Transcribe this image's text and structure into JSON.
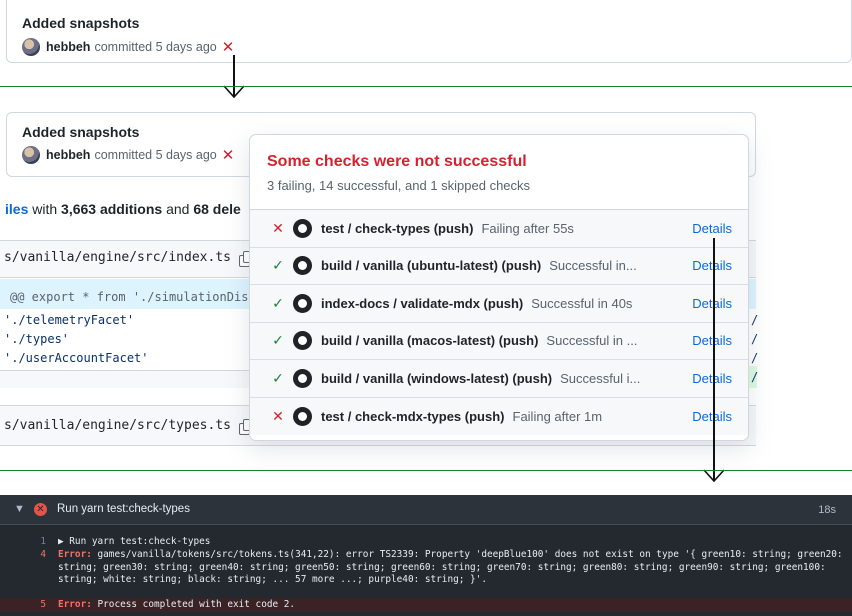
{
  "commit_top": {
    "title": "Added snapshots",
    "author": "hebbeh",
    "meta": "committed 5 days ago",
    "status_icon": "x-mark-icon"
  },
  "commit_mid": {
    "title": "Added snapshots",
    "author": "hebbeh",
    "meta": "committed 5 days ago",
    "status_icon": "x-mark-icon"
  },
  "files_summary": {
    "link": "iles",
    "with": " with ",
    "additions": "3,663 additions",
    "and": " and ",
    "deletions": "68 dele"
  },
  "file1": {
    "path": "s/vanilla/engine/src/index.ts",
    "hunk": "@@ export * from './simulationDis",
    "lines": [
      "'./telemetryFacet'",
      "'./types'",
      "'./userAccountFacet'"
    ]
  },
  "file2": {
    "path": "s/vanilla/engine/src/types.ts"
  },
  "right_fragments": [
    "/",
    "/",
    "/",
    "/"
  ],
  "popover": {
    "title": "Some checks were not successful",
    "subtitle": "3 failing, 14 successful, and 1 skipped checks",
    "details_label": "Details",
    "checks": [
      {
        "status": "fail",
        "icon": "x-mark",
        "name": "test / check-types (push)",
        "desc": "Failing after 55s"
      },
      {
        "status": "pass",
        "icon": "check-mark",
        "name": "build / vanilla (ubuntu-latest) (push)",
        "desc": "Successful in..."
      },
      {
        "status": "pass",
        "icon": "check-mark",
        "name": "index-docs / validate-mdx (push)",
        "desc": "Successful in 40s"
      },
      {
        "status": "pass",
        "icon": "check-mark",
        "name": "build / vanilla (macos-latest) (push)",
        "desc": "Successful in ..."
      },
      {
        "status": "pass",
        "icon": "check-mark",
        "name": "build / vanilla (windows-latest) (push)",
        "desc": "Successful i..."
      },
      {
        "status": "fail",
        "icon": "x-mark",
        "name": "test / check-mdx-types (push)",
        "desc": "Failing after 1m"
      }
    ]
  },
  "log": {
    "title": "Run yarn test:check-types",
    "time": "18s",
    "lines": [
      {
        "num": "1",
        "text": "▶ Run yarn test:check-types"
      },
      {
        "num": "4",
        "prefix": "Error:",
        "text": " games/vanilla/tokens/src/tokens.ts(341,22): error TS2339: Property 'deepBlue100' does not exist on type '{ green10: string; green20:"
      },
      {
        "num": "",
        "text": "string; green30: string; green40: string; green50: string; green60: string; green70: string; green80: string; green90: string; green100:"
      },
      {
        "num": "",
        "text": "string; white: string; black: string; ... 57 more ...; purple40: string; }'."
      },
      {
        "num": "5",
        "prefix": "Error:",
        "text": " Process completed with exit code 2."
      }
    ]
  },
  "colors": {
    "fail": "#cf222e",
    "pass": "#1a7f37",
    "link": "#0969da",
    "title_error": "#d1242f"
  }
}
